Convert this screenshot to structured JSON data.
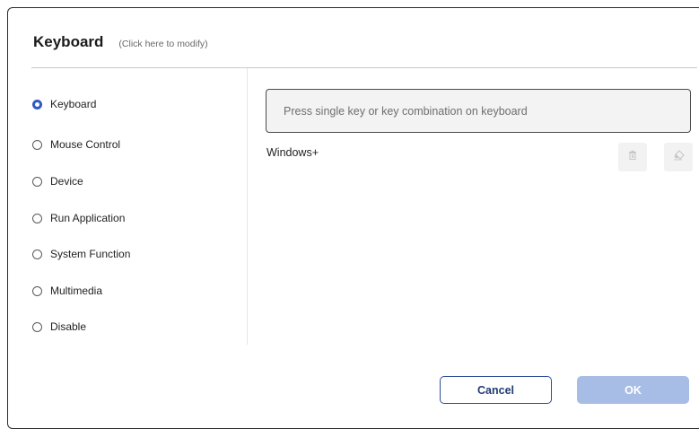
{
  "header": {
    "title": "Keyboard",
    "subtitle": "(Click here to modify)"
  },
  "options": [
    {
      "label": "Keyboard",
      "checked": true
    },
    {
      "label": "Mouse Control",
      "checked": false
    },
    {
      "label": "Device",
      "checked": false
    },
    {
      "label": "Run Application",
      "checked": false
    },
    {
      "label": "System Function",
      "checked": false
    },
    {
      "label": "Multimedia",
      "checked": false
    },
    {
      "label": "Disable",
      "checked": false
    }
  ],
  "key_input": {
    "placeholder": "Press single key or key combination on keyboard"
  },
  "combination": "Windows+",
  "buttons": {
    "cancel": "Cancel",
    "ok": "OK"
  },
  "colors": {
    "accent": "#2f59c4",
    "ok_disabled": "#a8bde6"
  },
  "icons": {
    "delete": "trash-icon",
    "clear": "eraser-icon"
  }
}
